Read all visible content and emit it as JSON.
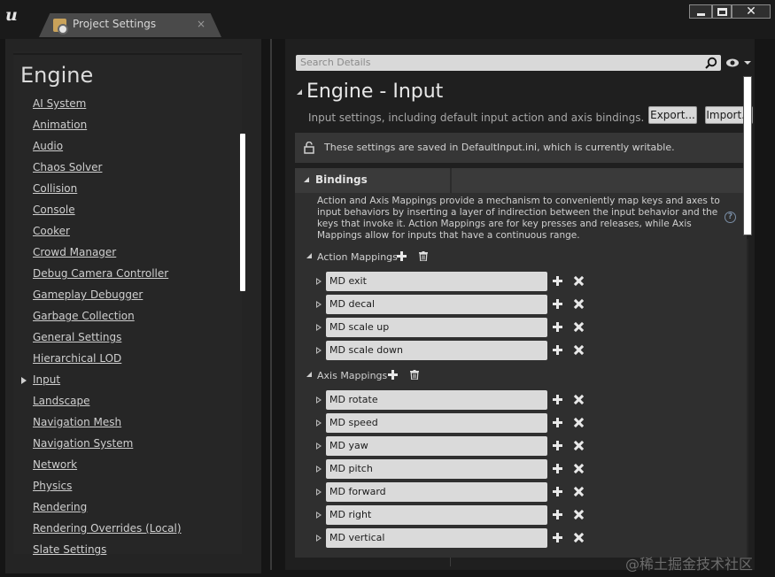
{
  "window": {
    "tab_title": "Project Settings",
    "tab_close": "×",
    "controls": [
      "minimize-button",
      "maximize-button",
      "close-button"
    ]
  },
  "sidebar": {
    "heading": "Engine",
    "active_item": "Input",
    "items": [
      "AI System",
      "Animation",
      "Audio",
      "Chaos Solver",
      "Collision",
      "Console",
      "Cooker",
      "Crowd Manager",
      "Debug Camera Controller",
      "Gameplay Debugger",
      "Garbage Collection",
      "General Settings",
      "Hierarchical LOD",
      "Input",
      "Landscape",
      "Navigation Mesh",
      "Navigation System",
      "Network",
      "Physics",
      "Rendering",
      "Rendering Overrides (Local)",
      "Slate Settings"
    ]
  },
  "details": {
    "search_placeholder": "Search Details",
    "title": "Engine - Input",
    "description": "Input settings, including default input action and axis bindings.",
    "export_label": "Export...",
    "import_label": "Import...",
    "notice": "These settings are saved in DefaultInput.ini, which is currently writable."
  },
  "bindings": {
    "title": "Bindings",
    "description": "Action and Axis Mappings provide a mechanism to conveniently map keys and axes to input behaviors by inserting a layer of indirection between the input behavior and the keys that invoke it. Action Mappings are for key presses and releases, while Axis Mappings allow for inputs that have a continuous range.",
    "help": "?",
    "action_label": "Action Mappings",
    "action_mappings": [
      "MD exit",
      "MD decal",
      "MD scale up",
      "MD scale down"
    ],
    "axis_label": "Axis Mappings",
    "axis_mappings": [
      "MD rotate",
      "MD speed",
      "MD yaw",
      "MD pitch",
      "MD forward",
      "MD right",
      "MD vertical"
    ]
  },
  "watermark": "@稀土掘金技术社区",
  "colors": {
    "background": "#151515",
    "panel": "#242424",
    "field": "#dadada",
    "scrollbar": "#ffffff"
  }
}
